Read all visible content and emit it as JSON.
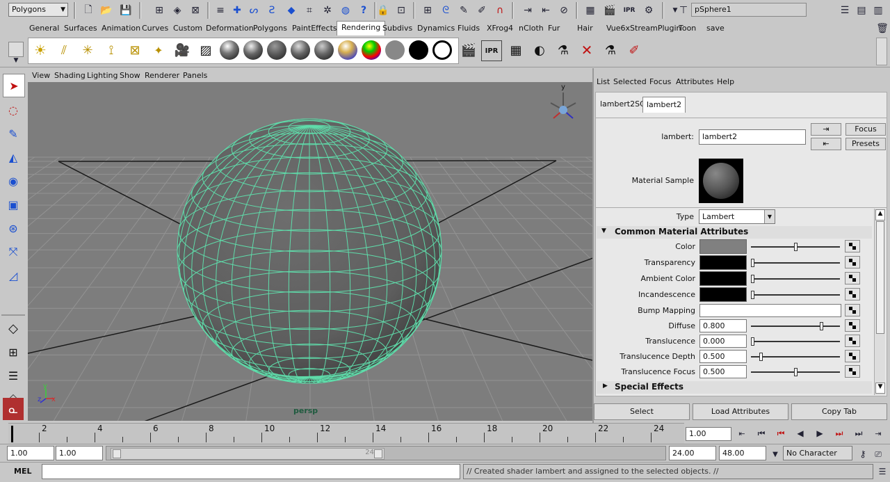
{
  "status_line": {
    "mode": "Polygons",
    "object_field": "pSphere1"
  },
  "shelf": {
    "tabs": [
      "General",
      "Surfaces",
      "Animation",
      "Curves",
      "Custom",
      "Deformation",
      "Polygons",
      "PaintEffects",
      "Rendering",
      "Subdivs",
      "Dynamics",
      "Fluids",
      "XFrog4",
      "nCloth",
      "Fur",
      "Hair",
      "Vue6xStreamPlugin",
      "Toon",
      "save"
    ],
    "active_tab": "Rendering"
  },
  "viewport": {
    "menu": [
      "View",
      "Shading",
      "Lighting",
      "Show",
      "Renderer",
      "Panels"
    ],
    "camera_label": "persp",
    "axis_x": "x",
    "axis_y": "y",
    "axis_z": "z"
  },
  "attr_editor": {
    "menu": [
      "List",
      "Selected",
      "Focus",
      "Attributes",
      "Help"
    ],
    "tabs": [
      "lambert2SG",
      "lambert2"
    ],
    "active_tab": "lambert2",
    "name_label": "lambert:",
    "name_value": "lambert2",
    "focus_btn": "Focus",
    "presets_btn": "Presets",
    "material_sample_label": "Material Sample",
    "type_label": "Type",
    "type_value": "Lambert",
    "section_common": "Common Material Attributes",
    "section_special": "Special Effects",
    "attrs": [
      {
        "label": "Color",
        "kind": "swatch",
        "color": "#808080",
        "slider": 0.5
      },
      {
        "label": "Transparency",
        "kind": "swatch",
        "color": "#000000",
        "slider": 0.0
      },
      {
        "label": "Ambient Color",
        "kind": "swatch",
        "color": "#000000",
        "slider": 0.0
      },
      {
        "label": "Incandescence",
        "kind": "swatch",
        "color": "#000000",
        "slider": 0.0
      },
      {
        "label": "Bump Mapping",
        "kind": "empty"
      },
      {
        "label": "Diffuse",
        "kind": "value",
        "value": "0.800",
        "slider": 0.8
      },
      {
        "label": "Translucence",
        "kind": "value",
        "value": "0.000",
        "slider": 0.0
      },
      {
        "label": "Translucence Depth",
        "kind": "value",
        "value": "0.500",
        "slider": 0.1
      },
      {
        "label": "Translucence Focus",
        "kind": "value",
        "value": "0.500",
        "slider": 0.5
      }
    ],
    "bottom_buttons": [
      "Select",
      "Load Attributes",
      "Copy Tab"
    ]
  },
  "time_slider": {
    "ticks": [
      "2",
      "4",
      "6",
      "8",
      "10",
      "12",
      "14",
      "16",
      "18",
      "20",
      "22",
      "24"
    ],
    "current_frame": "1.00"
  },
  "range_slider": {
    "start_min": "1.00",
    "start": "1.00",
    "range_end_marker": "24",
    "end": "24.00",
    "end_max": "48.00",
    "character_set": "No Character Set"
  },
  "command_line": {
    "lang": "MEL",
    "feedback": "// Created shader lambert and assigned to the selected objects. //"
  },
  "colors": {
    "wireframe": "#5fdcaa",
    "viewport_bg": "#7d7d7d"
  }
}
